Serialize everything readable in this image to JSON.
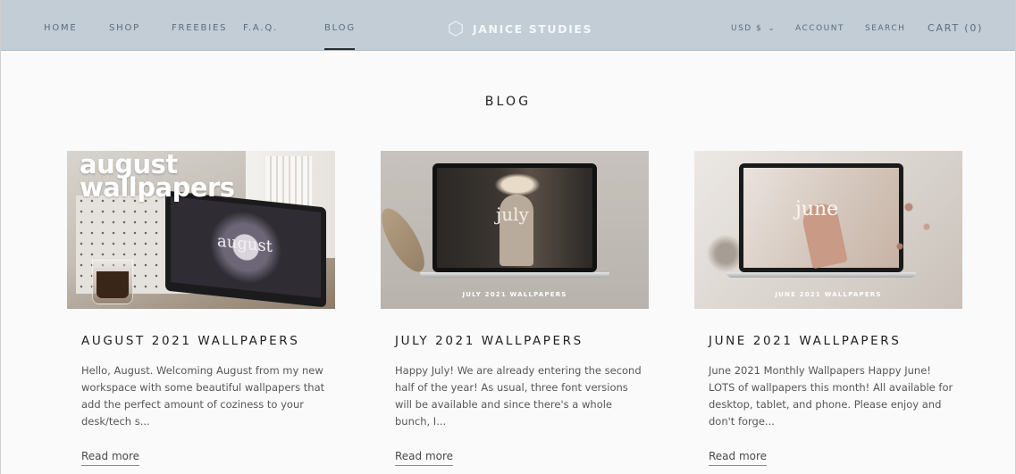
{
  "nav": {
    "left": [
      "HOME",
      "SHOP",
      "FREEBIES",
      "F.A.Q.",
      "BLOG"
    ],
    "active": "BLOG",
    "brand": "JANICE STUDIES",
    "currency": "USD $",
    "account": "ACCOUNT",
    "search": "SEARCH",
    "cart": "CART (0)"
  },
  "page": {
    "title": "BLOG"
  },
  "posts": [
    {
      "title": "AUGUST 2021 WALLPAPERS",
      "excerpt": "Hello, August.  Welcoming August from my new workspace with some beautiful wallpapers that add the perfect amount of coziness to your desk/tech s...",
      "read_more": "Read more",
      "image_text": "august\nwallpapers",
      "screen_text": "august"
    },
    {
      "title": "JULY 2021 WALLPAPERS",
      "excerpt": "Happy July! We are already entering the second half of the year! As usual, three font versions will be available and since there's a whole bunch, I...",
      "read_more": "Read more",
      "screen_text": "july",
      "image_caption": "JULY 2021 WALLPAPERS"
    },
    {
      "title": "JUNE 2021 WALLPAPERS",
      "excerpt": "June 2021 Monthly Wallpapers Happy June!  LOTS of wallpapers this month! All available for desktop, tablet, and phone. Please enjoy and don't forge...",
      "read_more": "Read more",
      "screen_text": "june",
      "image_caption": "JUNE 2021 WALLPAPERS"
    }
  ],
  "colors": {
    "header_bg": "#c2cdd6",
    "nav_text": "#5b6d7b",
    "page_bg": "#fafafa"
  }
}
